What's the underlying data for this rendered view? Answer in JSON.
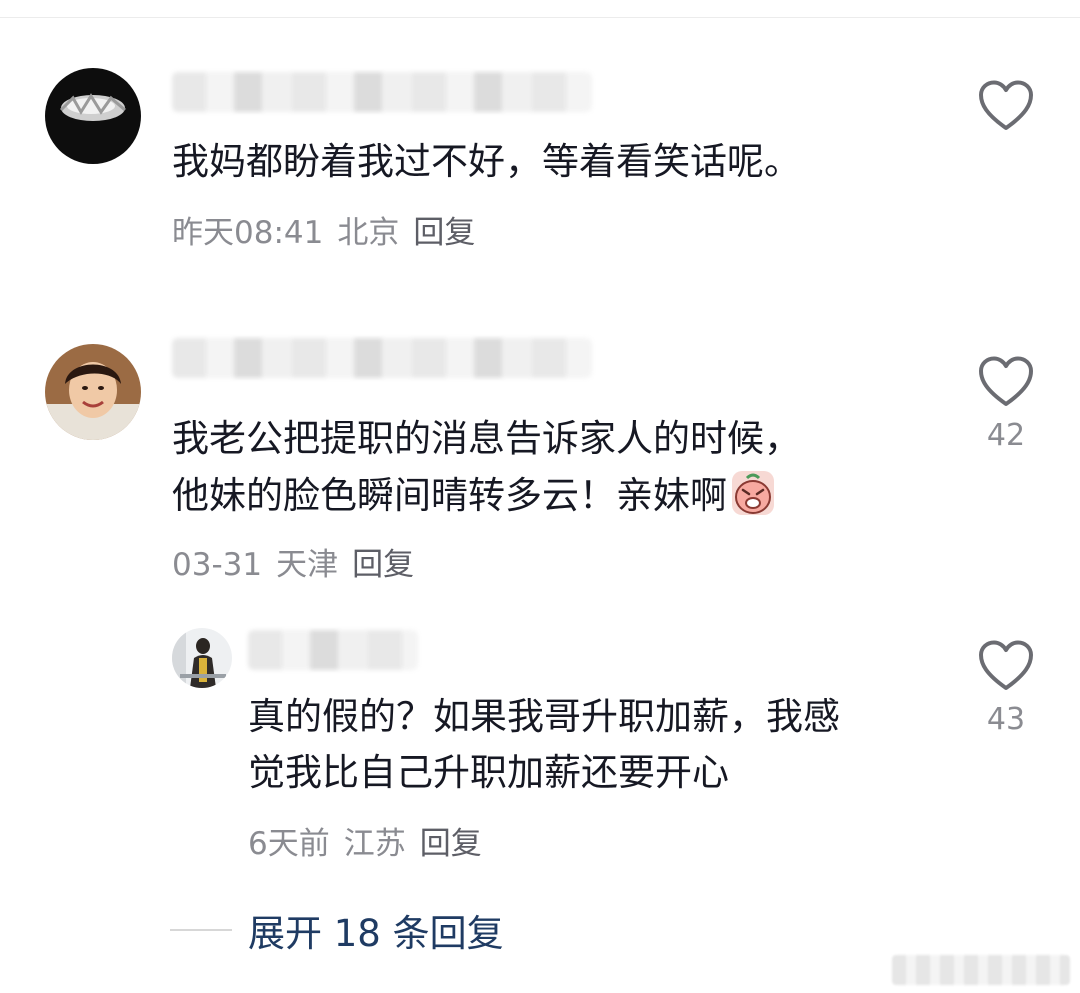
{
  "comments": [
    {
      "text": "我妈都盼着我过不好，等着看笑话呢。",
      "time": "昨天08:41",
      "location": "北京",
      "reply": "回复"
    },
    {
      "text_line1": "我老公把提职的消息告诉家人的时候，",
      "text_line2": "他妹的脸色瞬间晴转多云！亲妹啊",
      "time": "03-31",
      "location": "天津",
      "reply": "回复",
      "likes": "42",
      "sticker_icon": "crying-face-sticker"
    }
  ],
  "sub_reply": {
    "text_line1": "真的假的？如果我哥升职加薪，我感",
    "text_line2": "觉我比自己升职加薪还要开心",
    "time": "6天前",
    "location": "江苏",
    "reply": "回复",
    "likes": "43"
  },
  "expand_replies": "展开 18 条回复",
  "colors": {
    "primary_text": "#161823",
    "meta_text": "#8a8b91",
    "expand_link": "#1f3b63",
    "heart_outline": "#6b6c72"
  }
}
